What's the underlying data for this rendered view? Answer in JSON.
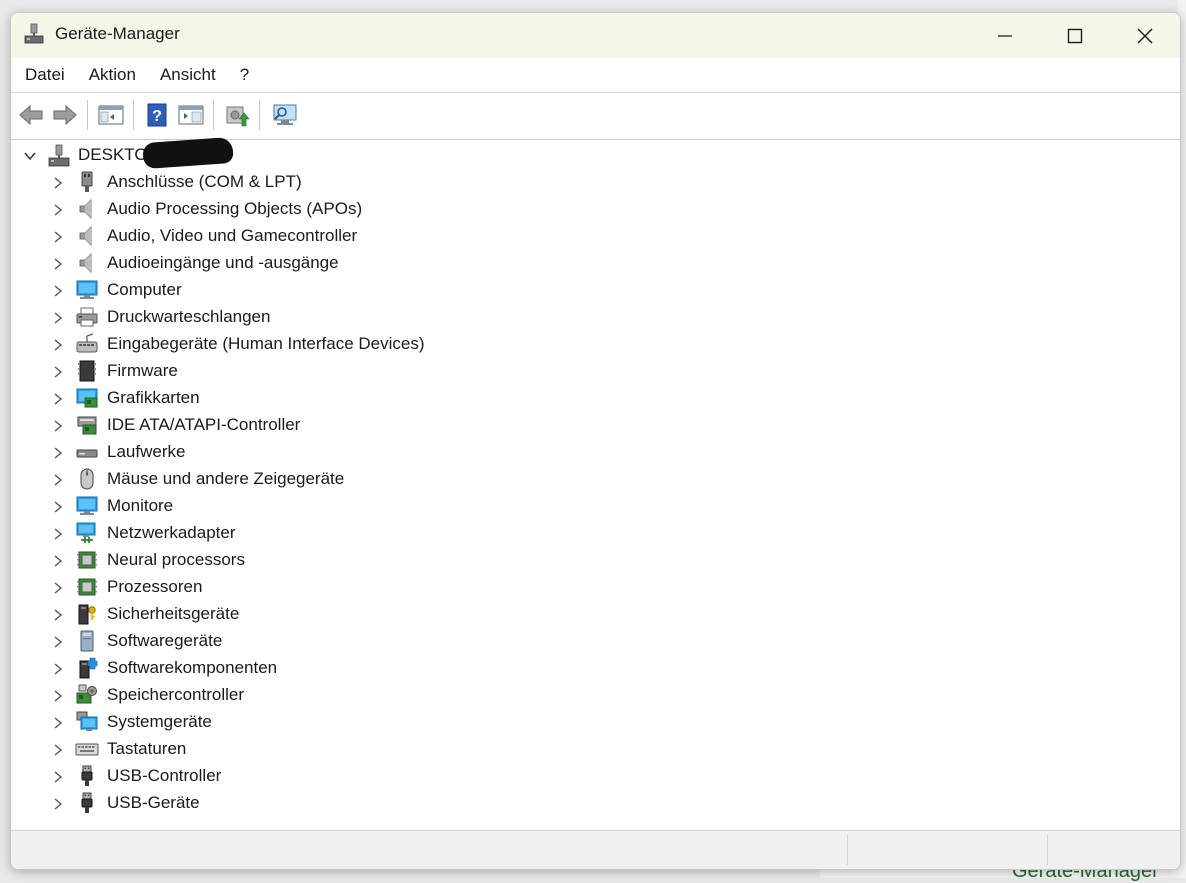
{
  "window": {
    "title": "Geräte-Manager"
  },
  "menu": [
    "Datei",
    "Aktion",
    "Ansicht",
    "?"
  ],
  "toolbar": [
    "back-icon",
    "forward-icon",
    "show-hide-console-tree-icon",
    "help-icon",
    "properties-icon",
    "update-driver-icon",
    "scan-hardware-icon"
  ],
  "tree": {
    "root": "DESKTOP-",
    "items": [
      {
        "label": "Anschlüsse (COM & LPT)",
        "icon": "port-icon"
      },
      {
        "label": "Audio Processing Objects (APOs)",
        "icon": "speaker-icon"
      },
      {
        "label": "Audio, Video und Gamecontroller",
        "icon": "speaker-icon"
      },
      {
        "label": "Audioeingänge und -ausgänge",
        "icon": "speaker-icon"
      },
      {
        "label": "Computer",
        "icon": "monitor-icon"
      },
      {
        "label": "Druckwarteschlangen",
        "icon": "printer-icon"
      },
      {
        "label": "Eingabegeräte (Human Interface Devices)",
        "icon": "hid-icon"
      },
      {
        "label": "Firmware",
        "icon": "firmware-icon"
      },
      {
        "label": "Grafikkarten",
        "icon": "display-adapter-icon"
      },
      {
        "label": "IDE ATA/ATAPI-Controller",
        "icon": "ide-controller-icon"
      },
      {
        "label": "Laufwerke",
        "icon": "drive-icon"
      },
      {
        "label": "Mäuse und andere Zeigegeräte",
        "icon": "mouse-icon"
      },
      {
        "label": "Monitore",
        "icon": "monitor-icon"
      },
      {
        "label": "Netzwerkadapter",
        "icon": "network-icon"
      },
      {
        "label": "Neural processors",
        "icon": "chip-icon"
      },
      {
        "label": "Prozessoren",
        "icon": "chip-icon"
      },
      {
        "label": "Sicherheitsgeräte",
        "icon": "security-key-icon"
      },
      {
        "label": "Softwaregeräte",
        "icon": "software-device-icon"
      },
      {
        "label": "Softwarekomponenten",
        "icon": "software-component-icon"
      },
      {
        "label": "Speichercontroller",
        "icon": "storage-controller-icon"
      },
      {
        "label": "Systemgeräte",
        "icon": "system-icon"
      },
      {
        "label": "Tastaturen",
        "icon": "keyboard-icon"
      },
      {
        "label": "USB-Controller",
        "icon": "usb-icon"
      },
      {
        "label": "USB-Geräte",
        "icon": "usb-icon"
      }
    ]
  },
  "background": {
    "partial_text": "Geräte-Manager"
  }
}
